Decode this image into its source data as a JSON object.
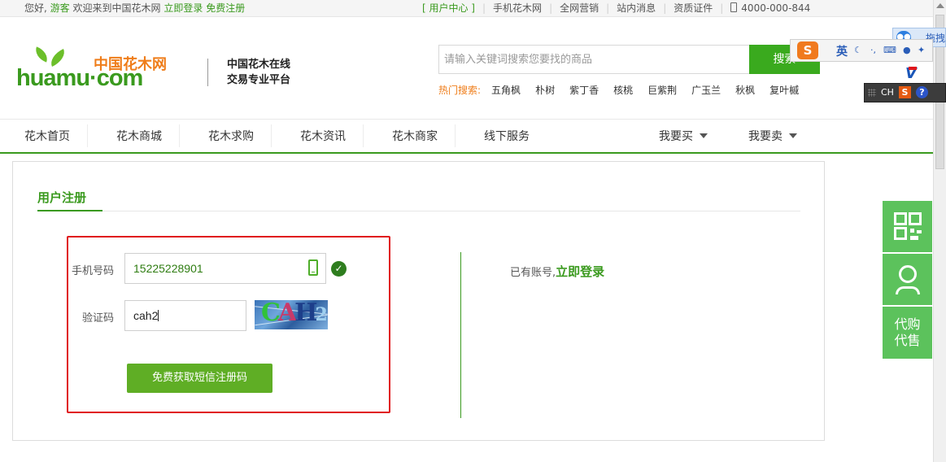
{
  "topbar": {
    "greeting": "您好,",
    "guest": "游客",
    "welcome": "欢迎来到中国花木网",
    "login": "立即登录",
    "register": "免费注册",
    "user_center": "[ 用户中心 ]",
    "links": [
      "手机花木网",
      "全网营销",
      "站内消息",
      "资质证件"
    ],
    "phone": "4000-000-844"
  },
  "header": {
    "logo_cn": "中国花木网",
    "logo_en": "huamu·com",
    "slogan_line1": "中国花木在线",
    "slogan_line2": "交易专业平台",
    "search_placeholder": "请输入关键词搜索您要找的商品",
    "search_button": "搜索",
    "hot_label": "热门搜索:",
    "hot_keywords": [
      "五角枫",
      "朴树",
      "紫丁香",
      "核桃",
      "巨紫荆",
      "广玉兰",
      "秋枫",
      "复叶槭"
    ]
  },
  "nav": {
    "items": [
      "花木首页",
      "花木商城",
      "花木求购",
      "花木资讯",
      "花木商家",
      "线下服务"
    ],
    "buy": "我要买",
    "sell": "我要卖"
  },
  "register": {
    "title": "用户注册",
    "phone_label": "手机号码",
    "phone_value": "15225228901",
    "code_label": "验证码",
    "code_value": "cah2",
    "captcha_chars": [
      "C",
      "A",
      "H",
      "2"
    ],
    "sms_button": "免费获取短信注册码",
    "has_account": "已有账号,",
    "login_link": "立即登录"
  },
  "side_tools": {
    "proxy_line1": "代购",
    "proxy_line2": "代售"
  },
  "overlays": {
    "sogou_letter": "S",
    "ime_mode": "英",
    "baidu_text": "拖拽",
    "ime_lang": "CH",
    "ime_s": "S",
    "ime_help": "?"
  },
  "colors": {
    "brand_green": "#3a9a1e",
    "brand_orange": "#ef7d1a",
    "highlight_red": "#e0161b",
    "tool_green": "#5cc25c"
  }
}
